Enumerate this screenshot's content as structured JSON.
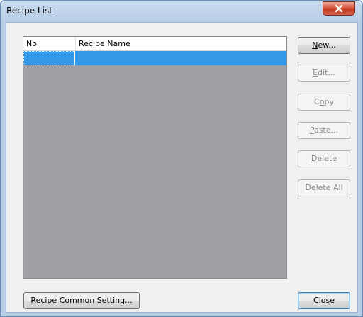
{
  "window": {
    "title": "Recipe List"
  },
  "list": {
    "columns": [
      "No.",
      "Recipe Name"
    ],
    "selected_row": {
      "no": "",
      "name": ""
    }
  },
  "buttons": {
    "new": "New...",
    "edit": "Edit...",
    "copy": "Copy",
    "paste": "Paste...",
    "delete": "Delete",
    "delete_all": "Delete All",
    "common_setting": "Recipe Common Setting...",
    "close": "Close"
  },
  "colors": {
    "titlebar": "#b7cde6",
    "selection": "#3399e8",
    "list_background": "#a0a0a4",
    "close_button": "#c23a20"
  },
  "icons": {
    "close": "close-x-icon"
  }
}
